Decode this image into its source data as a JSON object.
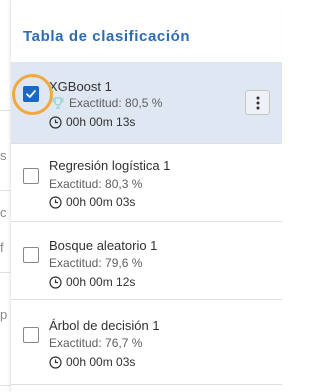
{
  "panel": {
    "title": "Tabla de clasificación",
    "models": [
      {
        "name": "XGBoost 1",
        "accuracy": "Exactitud: 80,5 %",
        "duration": "00h 00m 13s",
        "selected": true
      },
      {
        "name": "Regresión logística 1",
        "accuracy": "Exactitud: 80,3 %",
        "duration": "00h 00m 03s",
        "selected": false
      },
      {
        "name": "Bosque aleatorio 1",
        "accuracy": "Exactitud: 79,6 %",
        "duration": "00h 00m 12s",
        "selected": false
      },
      {
        "name": "Árbol de decisión 1",
        "accuracy": "Exactitud: 76,7 %",
        "duration": "00h 00m 03s",
        "selected": false
      }
    ]
  },
  "left_fragments": [
    "s",
    "c",
    "f",
    "p"
  ],
  "colors": {
    "accent": "#2b6cb5",
    "checkbox": "#1868c4",
    "selected_row": "#dfe7f3",
    "focus_ring": "#f2a93b"
  },
  "icons": {
    "best_model": "trophy-icon",
    "duration": "clock-icon",
    "actions": "more-vertical-icon",
    "selected": "checkmark-icon"
  }
}
